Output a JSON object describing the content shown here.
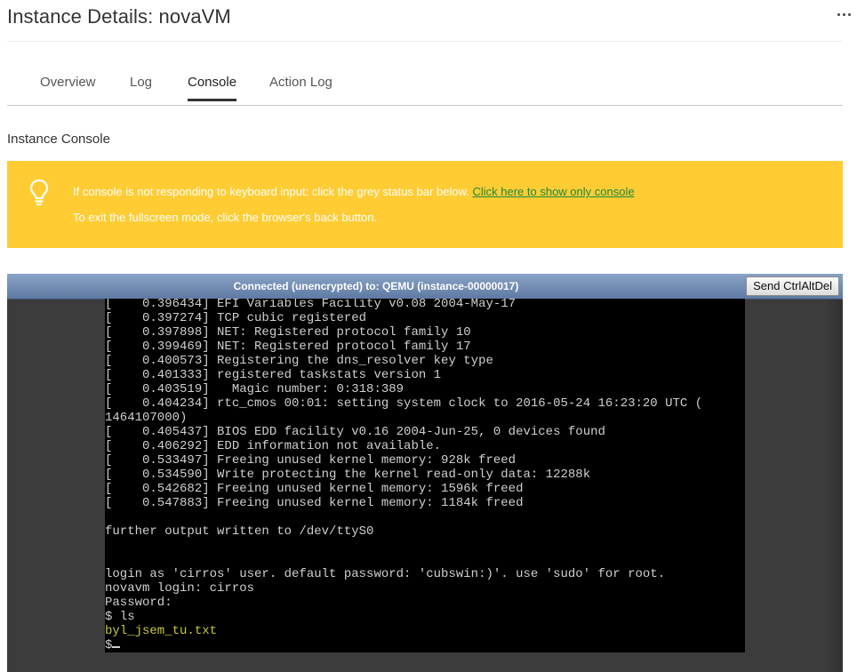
{
  "header": {
    "title": "Instance Details: novaVM"
  },
  "tabs": [
    {
      "label": "Overview",
      "active": false
    },
    {
      "label": "Log",
      "active": false
    },
    {
      "label": "Console",
      "active": true
    },
    {
      "label": "Action Log",
      "active": false
    }
  ],
  "section": {
    "title": "Instance Console"
  },
  "notice": {
    "icon": "lightbulb-icon",
    "line1_text": "If console is not responding to keyboard input: click the grey status bar below. ",
    "line1_link": "Click here to show only console",
    "line2_text": "To exit the fullscreen mode, click the browser's back button.",
    "background_color": "#ffcc33",
    "link_color": "#1a8a3c"
  },
  "console": {
    "status": "Connected (unencrypted) to: QEMU (instance-00000017)",
    "send_button": "Send CtrlAltDel",
    "lines": [
      "[    0.396434] EFI Variables Facility v0.08 2004-May-17",
      "[    0.397274] TCP cubic registered",
      "[    0.397898] NET: Registered protocol family 10",
      "[    0.399469] NET: Registered protocol family 17",
      "[    0.400573] Registering the dns_resolver key type",
      "[    0.401333] registered taskstats version 1",
      "[    0.403519]   Magic number: 0:318:389",
      "[    0.404234] rtc_cmos 00:01: setting system clock to 2016-05-24 16:23:20 UTC (",
      "1464107000)",
      "[    0.405437] BIOS EDD facility v0.16 2004-Jun-25, 0 devices found",
      "[    0.406292] EDD information not available.",
      "[    0.533497] Freeing unused kernel memory: 928k freed",
      "[    0.534590] Write protecting the kernel read-only data: 12288k",
      "[    0.542682] Freeing unused kernel memory: 1596k freed",
      "[    0.547883] Freeing unused kernel memory: 1184k freed",
      "",
      "further output written to /dev/ttyS0",
      "",
      "",
      "login as 'cirros' user. default password: 'cubswin:)'. use 'sudo' for root.",
      "novavm login: cirros",
      "Password:",
      "$ ls",
      "byl_jsem_tu.txt",
      "$"
    ],
    "highlight_line_index": 23,
    "highlight_color": "#c8c83a"
  }
}
